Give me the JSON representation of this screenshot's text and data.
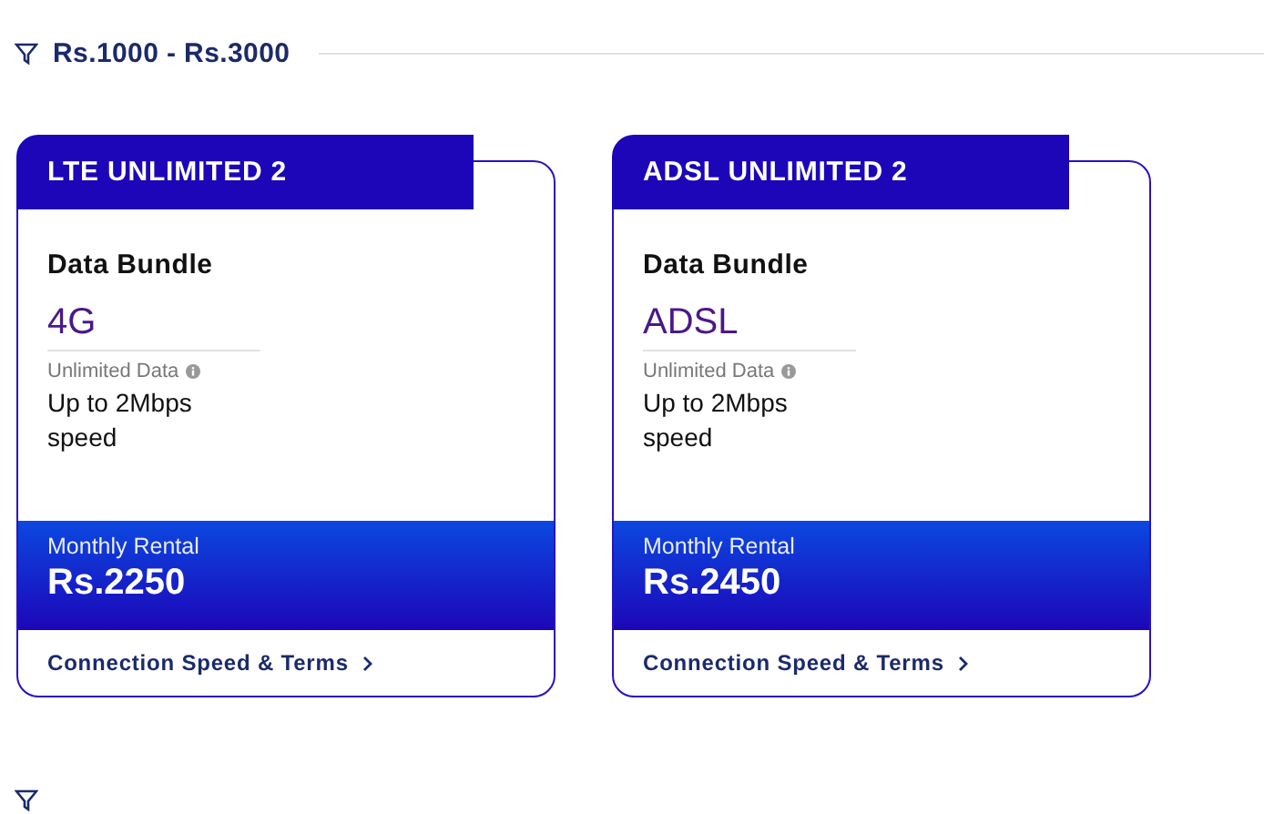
{
  "section": {
    "range": "Rs.1000 - Rs.3000"
  },
  "plans": [
    {
      "name": "LTE UNLIMITED 2",
      "category": "Data Bundle",
      "type": "4G",
      "data_label": "Unlimited Data",
      "speed": "Up to 2Mbps speed",
      "rental_label": "Monthly Rental",
      "price": "Rs.2250",
      "link": "Connection Speed & Terms"
    },
    {
      "name": "ADSL UNLIMITED 2",
      "category": "Data Bundle",
      "type": "ADSL",
      "data_label": "Unlimited Data",
      "speed": "Up to 2Mbps speed",
      "rental_label": "Monthly Rental",
      "price": "Rs.2450",
      "link": "Connection Speed & Terms"
    }
  ]
}
